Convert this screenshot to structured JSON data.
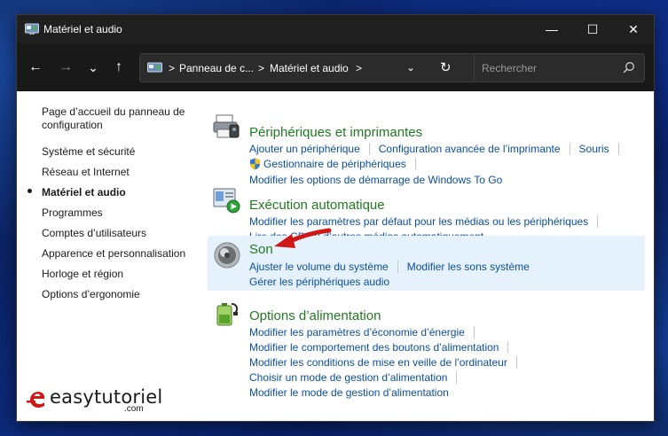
{
  "window": {
    "title": "Matériel et audio",
    "controls": {
      "minimize": "—",
      "maximize": "☐",
      "close": "✕"
    }
  },
  "navigation": {
    "back": "←",
    "forward": "→",
    "recent": "⌄",
    "up": "↑"
  },
  "address_bar": {
    "crumbs": [
      "Panneau de c...",
      "Matériel et audio"
    ],
    "separator": ">"
  },
  "search": {
    "placeholder": "Rechercher",
    "value": ""
  },
  "sidebar": {
    "items": [
      {
        "label": "Page d’accueil du panneau de configuration"
      },
      {
        "label": "Système et sécurité"
      },
      {
        "label": "Réseau et Internet"
      },
      {
        "label": "Matériel et audio",
        "current": true
      },
      {
        "label": "Programmes"
      },
      {
        "label": "Comptes d’utilisateurs"
      },
      {
        "label": "Apparence et personnalisation"
      },
      {
        "label": "Horloge et région"
      },
      {
        "label": "Options d’ergonomie"
      }
    ]
  },
  "categories": {
    "devices": {
      "title": "Périphériques et imprimantes",
      "links": [
        "Ajouter un périphérique",
        "Configuration avancée de l’imprimante",
        "Souris",
        "Gestionnaire de périphériques",
        "Modifier les options de démarrage de Windows To Go"
      ]
    },
    "autoplay": {
      "title": "Exécution automatique",
      "links": [
        "Modifier les paramètres par défaut pour les médias ou les périphériques",
        "Lire des CD ou d’autres médias automatiquement"
      ]
    },
    "sound": {
      "title": "Son",
      "links": [
        "Ajuster le volume du système",
        "Modifier les sons système",
        "Gérer les périphériques audio"
      ]
    },
    "power": {
      "title": "Options d’alimentation",
      "links": [
        "Modifier les paramètres d’économie d’énergie",
        "Modifier le comportement des boutons d’alimentation",
        "Modifier les conditions de mise en veille de l’ordinateur",
        "Choisir un mode de gestion d’alimentation",
        "Modifier le mode de gestion d’alimentation"
      ]
    }
  },
  "watermark": {
    "brand": "easytutoriel",
    "suffix": ".com"
  },
  "colors": {
    "category_title": "#217a21",
    "link": "#0b4fa0",
    "highlight": "#e5f1fb",
    "titlebar": "#202020",
    "annotation_arrow": "#d01818"
  }
}
